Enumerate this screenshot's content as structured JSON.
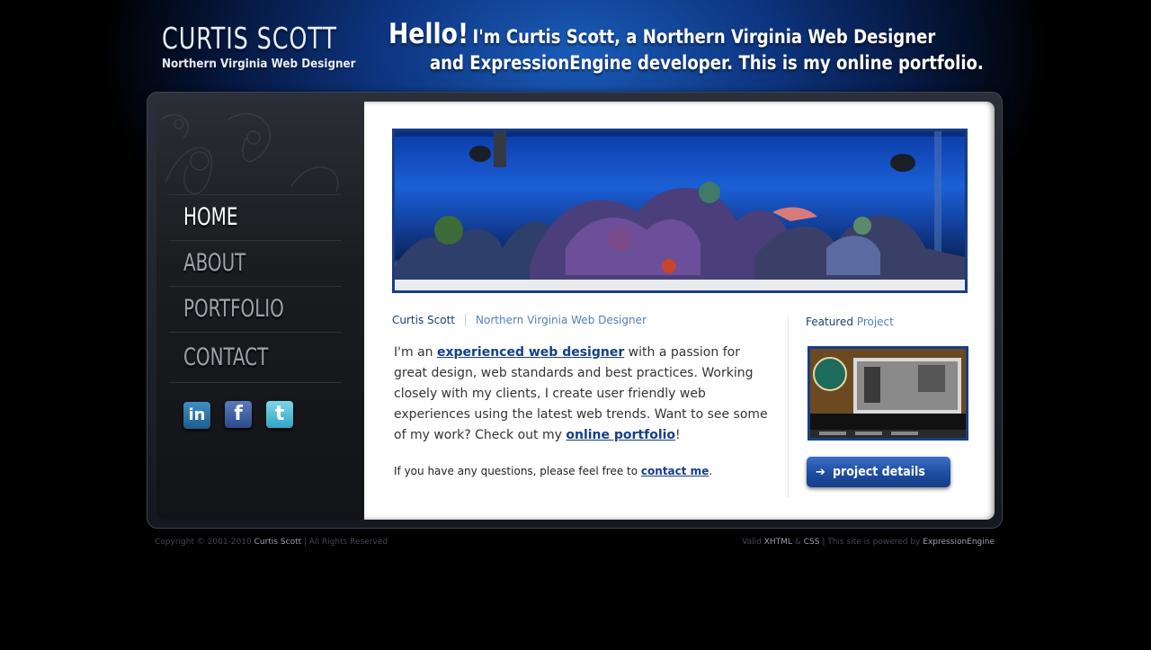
{
  "brand": {
    "name": "CURTIS SCOTT",
    "tagline": "Northern Virginia Web Designer"
  },
  "header": {
    "hello": "Hello!",
    "line1": "I'm Curtis Scott, a Northern Virginia Web Designer",
    "line2": "and ExpressionEngine developer. This is my online portfolio."
  },
  "nav": {
    "items": [
      {
        "label": "HOME",
        "active": true
      },
      {
        "label": "ABOUT",
        "active": false
      },
      {
        "label": "PORTFOLIO",
        "active": false
      },
      {
        "label": "CONTACT",
        "active": false
      }
    ]
  },
  "social": {
    "icons": [
      "linkedin-icon",
      "facebook-icon",
      "twitter-icon"
    ],
    "glyphs": [
      "in",
      "f",
      "t"
    ]
  },
  "crumbs": {
    "name": "Curtis Scott",
    "title": "Northern Virginia Web Designer"
  },
  "intro": {
    "p1": "I'm an ",
    "link1": "experienced web designer",
    "p2": " with a passion for great design, web standards and best practices. Working closely with my clients, I create user friendly web experiences using the latest web trends. Want to see some of my work? Check out my ",
    "link2": "online portfolio",
    "p3": "!"
  },
  "contact_note": {
    "text": "If you have any questions, please feel free to ",
    "link": "contact me",
    "end": "."
  },
  "featured": {
    "word1": "Featured",
    "word2": "Project",
    "button_label": "project details",
    "button_arrow": "➔"
  },
  "footer": {
    "copyright": "Copyright © 2001-2010",
    "owner": "Curtis Scott",
    "rights": "| All Rights Reserved",
    "valid": "Valid",
    "xhtml": "XHTML",
    "amp": "&",
    "css": "CSS",
    "powered": "| This site is powered by",
    "engine": "ExpressionEngine"
  },
  "colors": {
    "accent": "#143e8a",
    "link_light": "#4f7fb8",
    "background": "#000000",
    "sidebar": "#1a1c20"
  }
}
